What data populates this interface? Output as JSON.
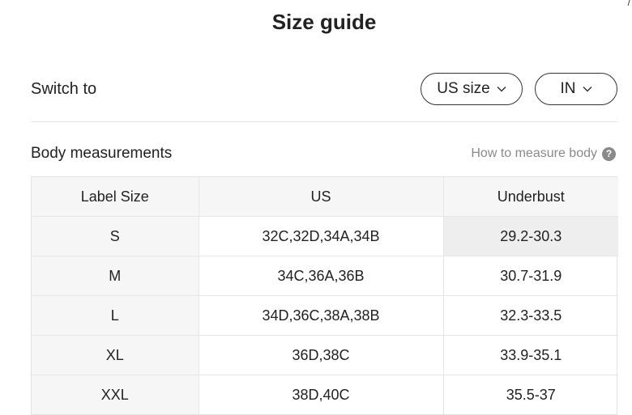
{
  "page": {
    "title": "Size guide",
    "corner_mark": "/"
  },
  "switch": {
    "label": "Switch to",
    "size_system": "US size",
    "unit": "IN"
  },
  "section": {
    "title": "Body measurements",
    "how_link": "How to measure body",
    "help_icon_glyph": "?"
  },
  "table": {
    "headers": [
      "Label Size",
      "US",
      "Underbust"
    ],
    "rows": [
      [
        "S",
        "32C,32D,34A,34B",
        "29.2-30.3"
      ],
      [
        "M",
        "34C,36A,36B",
        "30.7-31.9"
      ],
      [
        "L",
        "34D,36C,38A,38B",
        "32.3-33.5"
      ],
      [
        "XL",
        "36D,38C",
        "33.9-35.1"
      ],
      [
        "XXL",
        "38D,40C",
        "35.5-37"
      ]
    ]
  },
  "colors": {
    "text": "#222222",
    "muted": "#8a8a8a",
    "header_bg": "#f6f6f6",
    "highlight_bg": "#eeeeee",
    "border": "#e6e6e6"
  }
}
